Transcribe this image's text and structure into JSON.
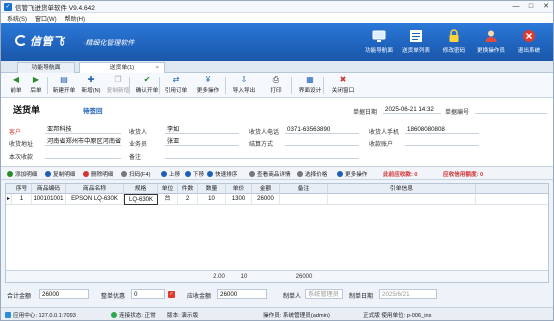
{
  "app": {
    "title": "信管飞进货单软件 V9.4.642"
  },
  "window_controls": {
    "minimize": "—",
    "maximize": "□",
    "close": "✕"
  },
  "menu": [
    "系统(S)",
    "窗口(W)",
    "帮助(H)"
  ],
  "banner": {
    "brand": "信管飞",
    "slogan_prefix": "·",
    "slogan": "精细化管理软件",
    "buttons": [
      {
        "label": "功能导航面",
        "icon": "navigation-icon"
      },
      {
        "label": "送货单列表",
        "icon": "list-icon"
      },
      {
        "label": "修改密码",
        "icon": "lock-icon"
      },
      {
        "label": "更换操作员",
        "icon": "user-icon"
      },
      {
        "label": "退出系统",
        "icon": "exit-icon"
      }
    ]
  },
  "tabs": [
    {
      "label": "功能导航面",
      "active": false
    },
    {
      "label": "送货单(1)",
      "active": true,
      "close": "×"
    }
  ],
  "toolbar": [
    {
      "label": "前单",
      "icon": "prev-icon",
      "glyph": "◀",
      "color": "#2a8a2a",
      "enabled": true
    },
    {
      "label": "后单",
      "icon": "next-icon",
      "glyph": "▶",
      "color": "#2a8a2a",
      "enabled": true
    },
    {
      "label": "新建开单",
      "icon": "new-doc-icon",
      "glyph": "▤",
      "color": "#1d5fb8",
      "enabled": true
    },
    {
      "label": "新增(N)",
      "icon": "add-icon",
      "glyph": "✚",
      "color": "#1d5fb8",
      "enabled": true
    },
    {
      "label": "复制新增",
      "icon": "copy-icon",
      "glyph": "❐",
      "color": "#999999",
      "enabled": false
    },
    {
      "label": "确认开单",
      "icon": "confirm-icon",
      "glyph": "✔",
      "color": "#2a8a2a",
      "enabled": true
    },
    {
      "label": "引用订单",
      "icon": "quote-icon",
      "glyph": "⇄",
      "color": "#1d5fb8",
      "enabled": true
    },
    {
      "label": "更多操作",
      "icon": "more-icon",
      "glyph": "¥",
      "color": "#1d5fb8",
      "enabled": true
    },
    {
      "label": "导入导出",
      "icon": "import-export-icon",
      "glyph": "⇩",
      "color": "#1d5fb8",
      "enabled": true
    },
    {
      "label": "打印",
      "icon": "print-icon",
      "glyph": "⎙",
      "color": "#333333",
      "enabled": true
    },
    {
      "label": "界面设计",
      "icon": "design-icon",
      "glyph": "▦",
      "color": "#1d5fb8",
      "enabled": true
    },
    {
      "label": "关闭窗口",
      "icon": "close-window-icon",
      "glyph": "✖",
      "color": "#d43333",
      "enabled": true
    }
  ],
  "doc": {
    "title": "送货单",
    "status": "待签回",
    "date_label": "单据日期",
    "date": "2025-06-21 14:32",
    "number_label": "单据编号",
    "number": ""
  },
  "fields": {
    "customer_label": "客户",
    "customer": "亚邦科技",
    "receiver_label": "收货人",
    "receiver": "李如",
    "receiver_phone_label": "收货人电话",
    "receiver_phone": "0371-63563890",
    "receiver_mobile_label": "收货人手机",
    "receiver_mobile": "18608080808",
    "address_label": "收货地址",
    "address": "河南省郑州市中原区河南省",
    "salesman_label": "业务员",
    "salesman": "张亚",
    "settlement_label": "结算方式",
    "settlement": "",
    "account_label": "收款账户",
    "account": "",
    "receipt_label": "本次收款",
    "receipt": "",
    "remark_label": "备注",
    "remark": ""
  },
  "grid_toolbar": {
    "buttons": [
      {
        "label": "添加明细",
        "color": "#2a8a2a"
      },
      {
        "label": "复制明细",
        "color": "#1d5fb8"
      },
      {
        "label": "删除明细",
        "color": "#d43333"
      },
      {
        "label": "扫码(F4)",
        "color": "#777777"
      },
      {
        "label": "上移",
        "color": "#1d5fb8"
      },
      {
        "label": "下移",
        "color": "#1d5fb8"
      },
      {
        "label": "快速排序",
        "color": "#1d5fb8"
      },
      {
        "label": "查看商品详情",
        "color": "#777777"
      },
      {
        "label": "选择价格",
        "color": "#777777"
      },
      {
        "label": "更多操作",
        "color": "#1d5fb8"
      }
    ],
    "balance_text": "此前应收款: 0",
    "credit_text": "应收信用额度: 0"
  },
  "grid": {
    "columns": [
      "序号",
      "商品编码",
      "商品名称",
      "规格",
      "单位",
      "件数",
      "数量",
      "单价",
      "金额",
      "备注",
      "引单信息"
    ],
    "rows": [
      [
        "1",
        "100101001",
        "EPSON LQ-630K",
        "LQ-630K",
        "台",
        "2",
        "10",
        "1300",
        "26000",
        "",
        ""
      ]
    ],
    "footer": {
      "pieces": "2.00",
      "quantity": "10",
      "amount": "26000"
    }
  },
  "summary": {
    "total_label": "合计金额",
    "total": "26000",
    "discount_label": "整单优惠",
    "discount": "0",
    "receivable_label": "应收金额",
    "receivable": "26000",
    "maker_label": "制单人",
    "maker": "系统管理员",
    "make_date_label": "制单日期",
    "make_date": "2025/6/21"
  },
  "statusbar": {
    "app_center": "应用中心: 127.0.0.1:7093",
    "connection": "连接状态: 正常",
    "version_type": "版本: 演示版",
    "operator": "操作员: 系统管理员(admin)",
    "license": "正式版  使用单位: p-006_ins"
  }
}
